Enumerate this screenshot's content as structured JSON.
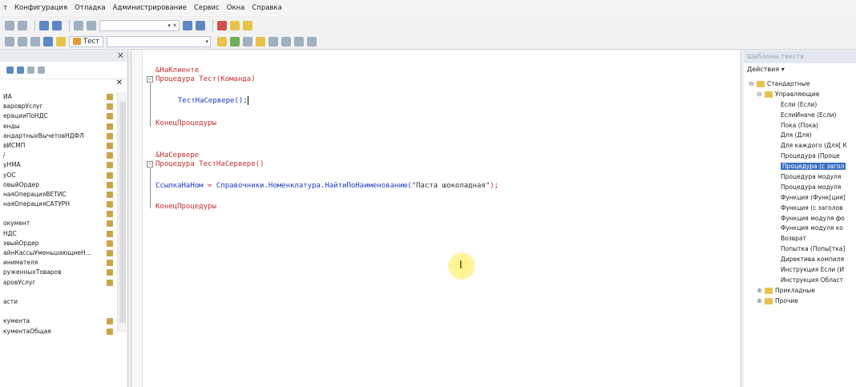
{
  "menu": [
    "т",
    "Конфигурация",
    "Отладка",
    "Администрирование",
    "Сервис",
    "Окна",
    "Справка"
  ],
  "toolbar": {
    "tab_label": "Тест"
  },
  "left_panel": {
    "items": [
      {
        "label": "ИА",
        "lock": true
      },
      {
        "label": "вароврУслуг",
        "lock": true
      },
      {
        "label": "ерацииПоНДС",
        "lock": true
      },
      {
        "label": "енды",
        "lock": true
      },
      {
        "label": "андартныхВычетовНДФЛ",
        "lock": true
      },
      {
        "label": "вИСМП",
        "lock": true
      },
      {
        "label": "/",
        "lock": true
      },
      {
        "label": "уНМА",
        "lock": true
      },
      {
        "label": "уОС",
        "lock": true
      },
      {
        "label": "овыйОрдер",
        "lock": true
      },
      {
        "label": "наяОперацияВЕТИС",
        "lock": true
      },
      {
        "label": "наяОперацияСАТУРН",
        "lock": true
      },
      {
        "label": "",
        "lock": true
      },
      {
        "label": "окумент",
        "lock": true
      },
      {
        "label": "НДС",
        "lock": true
      },
      {
        "label": "эвыйОрдер",
        "lock": true
      },
      {
        "label": "айнКассыУменьшающиеН...",
        "lock": true
      },
      {
        "label": "инимателя",
        "lock": true
      },
      {
        "label": "руженныхТоваров",
        "lock": true
      },
      {
        "label": "аровУслуг",
        "lock": true
      },
      {
        "label": "",
        "lock": false
      },
      {
        "label": "асти",
        "lock": false
      },
      {
        "label": "",
        "lock": false
      },
      {
        "label": "кумента",
        "lock": true
      },
      {
        "label": "кументаОбщая",
        "lock": true
      }
    ]
  },
  "editor": {
    "client_directive": "&НаКлиенте",
    "proc1_keyword": "Процедура",
    "proc1_name": "Тест(Команда)",
    "proc1_body": "ТестНаСервере();",
    "proc1_end": "КонецПроцедуры",
    "server_directive": "&НаСервере",
    "proc2_keyword": "Процедура",
    "proc2_name": "ТестНаСервере()",
    "proc2_body_var": "СсылкаНаНом",
    "proc2_body_eq": " = ",
    "proc2_body_expr": "Справочники.Номенклатура.НайтиПоНаименованию(",
    "proc2_body_str": "\"Паста шоколадная\"",
    "proc2_body_end": ");",
    "proc2_end": "КонецПроцедуры"
  },
  "right_panel": {
    "title": "Шаблоны текста",
    "actions": "Действия ▾",
    "tree": [
      {
        "label": "Стандартные",
        "level": 0,
        "folder": true,
        "exp": "⊖",
        "selected": false
      },
      {
        "label": "Управляющие",
        "level": 1,
        "folder": true,
        "exp": "⊖",
        "selected": false
      },
      {
        "label": "Если (Если)",
        "level": 2,
        "folder": false,
        "selected": false
      },
      {
        "label": "ЕслиИначе (Если)",
        "level": 2,
        "folder": false,
        "selected": false
      },
      {
        "label": "Пока (Пока)",
        "level": 2,
        "folder": false,
        "selected": false
      },
      {
        "label": "Для (Для)",
        "level": 2,
        "folder": false,
        "selected": false
      },
      {
        "label": "Для каждого (Для[ К",
        "level": 2,
        "folder": false,
        "selected": false
      },
      {
        "label": "Процедура (Проце",
        "level": 2,
        "folder": false,
        "selected": false
      },
      {
        "label": "Процедура (с загол",
        "level": 2,
        "folder": false,
        "selected": true
      },
      {
        "label": "Процедура модуля",
        "level": 2,
        "folder": false,
        "selected": false
      },
      {
        "label": "Процедура модуля",
        "level": 2,
        "folder": false,
        "selected": false
      },
      {
        "label": "Функция (Функ[ция]",
        "level": 2,
        "folder": false,
        "selected": false
      },
      {
        "label": "Функция (с заголов",
        "level": 2,
        "folder": false,
        "selected": false
      },
      {
        "label": "Функция модуля фо",
        "level": 2,
        "folder": false,
        "selected": false
      },
      {
        "label": "Функция модуля ко",
        "level": 2,
        "folder": false,
        "selected": false
      },
      {
        "label": "Возврат",
        "level": 2,
        "folder": false,
        "selected": false
      },
      {
        "label": "Попытка (Попы[тка]",
        "level": 2,
        "folder": false,
        "selected": false
      },
      {
        "label": "Директива компиля",
        "level": 2,
        "folder": false,
        "selected": false
      },
      {
        "label": "Инструкция Если (И",
        "level": 2,
        "folder": false,
        "selected": false
      },
      {
        "label": "Инструкция Област",
        "level": 2,
        "folder": false,
        "selected": false
      },
      {
        "label": "Прикладные",
        "level": 1,
        "folder": true,
        "exp": "⊕",
        "selected": false
      },
      {
        "label": "Прочие",
        "level": 1,
        "folder": true,
        "exp": "⊕",
        "selected": false
      }
    ]
  }
}
